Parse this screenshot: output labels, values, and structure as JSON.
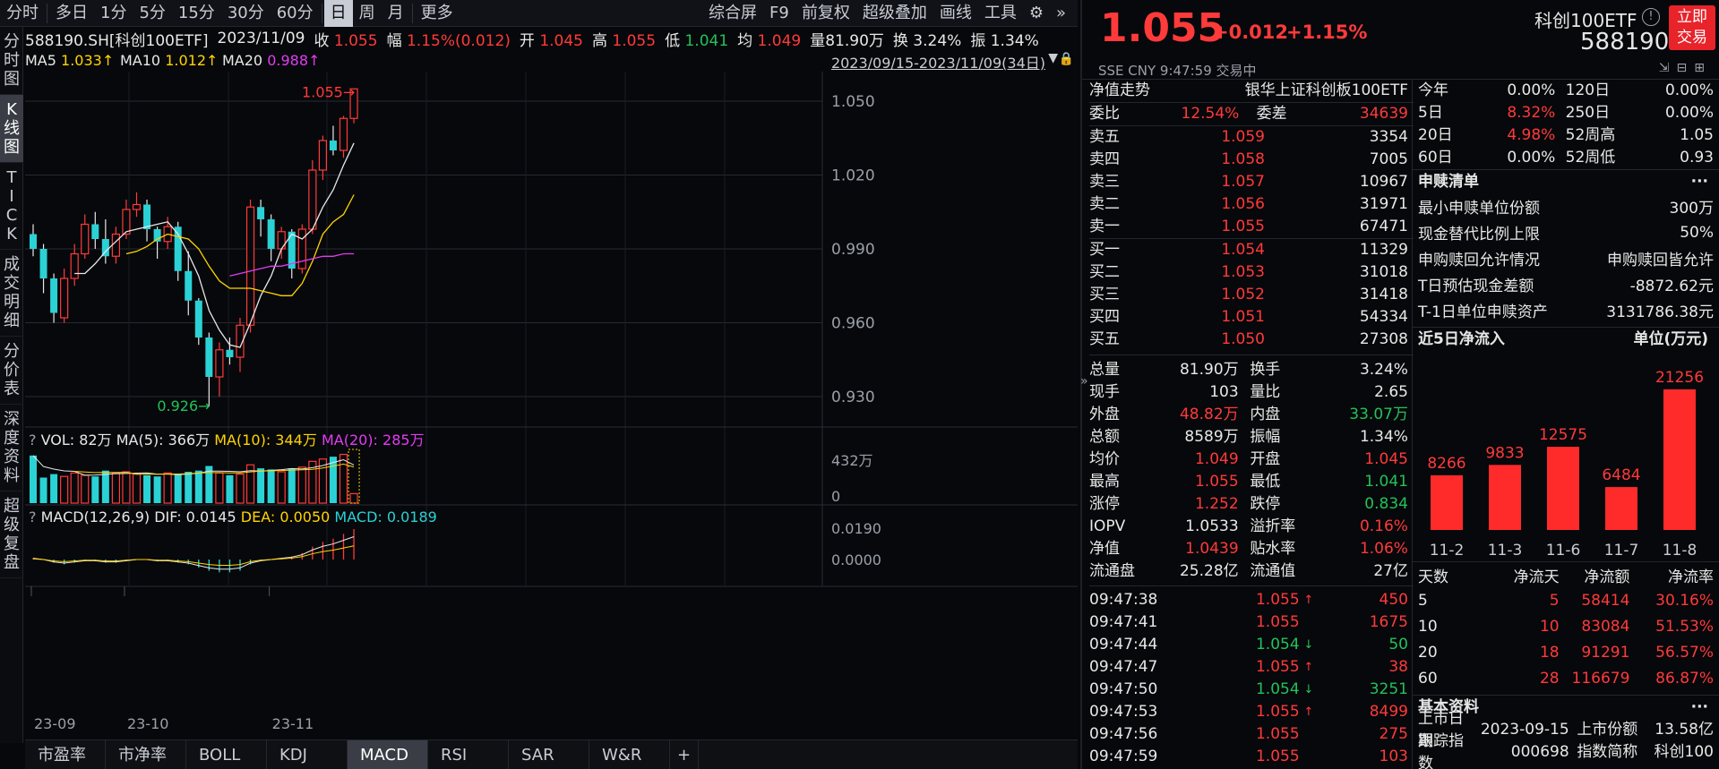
{
  "toolbar": {
    "periods": [
      "分时",
      "多日",
      "1分",
      "5分",
      "15分",
      "30分",
      "60分",
      "日",
      "周",
      "月",
      "更多"
    ],
    "active_period": "日",
    "right_items": [
      "综合屏",
      "F9",
      "前复权",
      "超级叠加",
      "画线",
      "工具"
    ],
    "gear_label": "⚙",
    "expand_label": "»"
  },
  "side_tabs": [
    "分时图",
    "K线图",
    "TICK",
    "成交明细",
    "分价表",
    "深度资料",
    "超级复盘"
  ],
  "active_side_tab": "K线图",
  "info": {
    "code": "588190.SH[科创100ETF]",
    "date": "2023/11/09",
    "close_label": "收",
    "close": "1.055",
    "amp_label": "幅",
    "amp": "1.15%(0.012)",
    "open_label": "开",
    "open": "1.045",
    "high_label": "高",
    "high": "1.055",
    "low_label": "低",
    "low": "1.041",
    "avg_label": "均",
    "avg": "1.049",
    "vol_label": "量",
    "vol": "81.90万",
    "turn_label": "换",
    "turn": "3.24%",
    "zhen_label": "振",
    "zhen": "1.34%"
  },
  "ma_row": {
    "ma5_label": "MA5",
    "ma5": "1.033↑",
    "ma10_label": "MA10",
    "ma10": "1.012↑",
    "ma20_label": "MA20",
    "ma20": "0.988↑",
    "range": "2023/09/15-2023/11/09(34日)"
  },
  "kline": {
    "price_ticks": [
      "1.050",
      "1.020",
      "0.990",
      "0.960",
      "0.930"
    ],
    "ymin": 0.918,
    "ymax": 1.062,
    "max_label": "1.055",
    "min_label": "0.926",
    "colors": {
      "up": "#ff3a3a",
      "down": "#2ad2d6",
      "ma5": "#e8e8e8",
      "ma10": "#ffd400",
      "ma20": "#e23cf3",
      "grid": "#262a31"
    },
    "candles": [
      [
        0.996,
        1.0,
        0.987,
        0.99
      ],
      [
        0.99,
        0.992,
        0.972,
        0.978
      ],
      [
        0.978,
        0.98,
        0.96,
        0.964
      ],
      [
        0.962,
        0.982,
        0.96,
        0.978
      ],
      [
        0.978,
        0.992,
        0.975,
        0.988
      ],
      [
        0.988,
        1.004,
        0.986,
        1.0
      ],
      [
        1.0,
        1.005,
        0.99,
        0.994
      ],
      [
        0.994,
        1.002,
        0.984,
        0.987
      ],
      [
        0.987,
        0.999,
        0.984,
        0.996
      ],
      [
        0.996,
        1.01,
        0.994,
        1.006
      ],
      [
        1.006,
        1.013,
        1.003,
        1.008
      ],
      [
        1.008,
        1.01,
        0.993,
        0.998
      ],
      [
        0.998,
        0.999,
        0.986,
        0.993
      ],
      [
        0.993,
        1.003,
        0.99,
        0.999
      ],
      [
        0.999,
        1.001,
        0.977,
        0.981
      ],
      [
        0.981,
        0.989,
        0.963,
        0.969
      ],
      [
        0.969,
        0.97,
        0.951,
        0.954
      ],
      [
        0.954,
        0.956,
        0.926,
        0.938
      ],
      [
        0.938,
        0.952,
        0.93,
        0.949
      ],
      [
        0.949,
        0.954,
        0.943,
        0.946
      ],
      [
        0.946,
        0.962,
        0.94,
        0.959
      ],
      [
        0.959,
        1.01,
        0.956,
        1.007
      ],
      [
        1.007,
        1.01,
        0.995,
        1.002
      ],
      [
        1.002,
        1.004,
        0.985,
        0.99
      ],
      [
        0.99,
        0.999,
        0.986,
        0.997
      ],
      [
        0.997,
        0.998,
        0.978,
        0.982
      ],
      [
        0.982,
        1.0,
        0.98,
        0.998
      ],
      [
        0.998,
        1.026,
        0.996,
        1.022
      ],
      [
        1.022,
        1.036,
        1.018,
        1.034
      ],
      [
        1.034,
        1.04,
        1.028,
        1.03
      ],
      [
        1.03,
        1.044,
        1.027,
        1.043
      ],
      [
        1.043,
        1.055,
        1.041,
        1.055
      ]
    ],
    "ma5": [
      null,
      null,
      null,
      null,
      0.98,
      0.98,
      0.984,
      0.989,
      0.993,
      0.997,
      0.998,
      0.999,
      1.0,
      1.001,
      0.996,
      0.988,
      0.979,
      0.965,
      0.957,
      0.951,
      0.95,
      0.96,
      0.971,
      0.979,
      0.99,
      0.996,
      0.994,
      0.998,
      1.007,
      1.014,
      1.024,
      1.033
    ],
    "ma10": [
      null,
      null,
      null,
      null,
      null,
      null,
      null,
      null,
      null,
      0.988,
      0.989,
      0.991,
      0.994,
      0.996,
      0.995,
      0.994,
      0.99,
      0.983,
      0.977,
      0.974,
      0.974,
      0.974,
      0.973,
      0.972,
      0.971,
      0.971,
      0.976,
      0.985,
      0.996,
      1.001,
      1.004,
      1.012
    ],
    "ma20": [
      null,
      null,
      null,
      null,
      null,
      null,
      null,
      null,
      null,
      null,
      null,
      null,
      null,
      null,
      null,
      null,
      null,
      null,
      null,
      0.979,
      0.98,
      0.981,
      0.982,
      0.983,
      0.983,
      0.984,
      0.985,
      0.986,
      0.987,
      0.987,
      0.988,
      0.988
    ],
    "date_labels": [
      "23-09",
      "23-10",
      "23-11"
    ]
  },
  "volume": {
    "title": "VOL: 82万",
    "ma5_label": "MA(5): 366万",
    "ma10_label": "MA(10): 344万",
    "ma20_label": "MA(20): 285万",
    "ticks": [
      "432万",
      "0"
    ],
    "max": 432,
    "values": [
      410,
      220,
      250,
      230,
      260,
      240,
      230,
      280,
      260,
      270,
      250,
      240,
      230,
      260,
      250,
      270,
      280,
      320,
      260,
      240,
      250,
      330,
      300,
      290,
      270,
      300,
      310,
      360,
      380,
      400,
      420,
      82
    ]
  },
  "macd": {
    "title": "MACD(12,26,9)",
    "dif_label": "DIF: 0.0145",
    "dea_label": "DEA: 0.0050",
    "macd_label": "MACD: 0.0189",
    "ticks": [
      "0.0190",
      "0.0000"
    ],
    "values": [
      0.001,
      0.0,
      -0.002,
      -0.003,
      -0.002,
      -0.001,
      -0.001,
      -0.002,
      -0.002,
      -0.001,
      0.0,
      0.0,
      -0.001,
      -0.001,
      -0.002,
      -0.003,
      -0.005,
      -0.007,
      -0.008,
      -0.008,
      -0.007,
      -0.003,
      -0.001,
      0.0,
      0.001,
      0.002,
      0.004,
      0.008,
      0.011,
      0.013,
      0.016,
      0.019
    ]
  },
  "bottom_tabs": [
    "市盈率",
    "市净率",
    "BOLL",
    "KDJ",
    "MACD",
    "RSI",
    "SAR",
    "W&R"
  ],
  "active_bottom_tab": "MACD",
  "plus_label": "+",
  "quote": {
    "price": "1.055",
    "change": "+0.012",
    "pct": "+1.15%",
    "name": "科创100ETF",
    "code": "588190",
    "trade_btn_line1": "立即",
    "trade_btn_line2": "交易",
    "market": "SSE  CNY  9:47:59  交易中"
  },
  "book": {
    "nav_title": "净值走势",
    "index_name": "银华上证科创板100ETF",
    "weibi_label": "委比",
    "weibi": "12.54%",
    "weicha_label": "委差",
    "weicha": "34639",
    "asks": [
      [
        "卖五",
        "1.059",
        "3354"
      ],
      [
        "卖四",
        "1.058",
        "7005"
      ],
      [
        "卖三",
        "1.057",
        "10967"
      ],
      [
        "卖二",
        "1.056",
        "31971"
      ],
      [
        "卖一",
        "1.055",
        "67471"
      ]
    ],
    "bids": [
      [
        "买一",
        "1.054",
        "11329"
      ],
      [
        "买二",
        "1.053",
        "31018"
      ],
      [
        "买三",
        "1.052",
        "31418"
      ],
      [
        "买四",
        "1.051",
        "54334"
      ],
      [
        "买五",
        "1.050",
        "27308"
      ]
    ]
  },
  "stats": [
    [
      [
        "总量",
        "81.90万",
        "white"
      ],
      [
        "换手",
        "3.24%",
        "white"
      ]
    ],
    [
      [
        "现手",
        "103",
        "white"
      ],
      [
        "量比",
        "2.65",
        "white"
      ]
    ],
    [
      [
        "外盘",
        "48.82万",
        "red"
      ],
      [
        "内盘",
        "33.07万",
        "green"
      ]
    ],
    [
      [
        "总额",
        "8589万",
        "white"
      ],
      [
        "振幅",
        "1.34%",
        "white"
      ]
    ],
    [
      [
        "均价",
        "1.049",
        "red"
      ],
      [
        "开盘",
        "1.045",
        "red"
      ]
    ],
    [
      [
        "最高",
        "1.055",
        "red"
      ],
      [
        "最低",
        "1.041",
        "green"
      ]
    ],
    [
      [
        "涨停",
        "1.252",
        "red"
      ],
      [
        "跌停",
        "0.834",
        "green"
      ]
    ],
    [
      [
        "IOPV",
        "1.0533",
        "white"
      ],
      [
        "溢折率",
        "0.16%",
        "red"
      ]
    ],
    [
      [
        "净值",
        "1.0439",
        "red"
      ],
      [
        "贴水率",
        "1.06%",
        "red"
      ]
    ],
    [
      [
        "流通盘",
        "25.28亿",
        "white"
      ],
      [
        "流通值",
        "27亿",
        "white"
      ]
    ]
  ],
  "ticks_list": [
    [
      "09:47:38",
      "1.055",
      "↑",
      "450",
      "red"
    ],
    [
      "09:47:41",
      "1.055",
      "",
      "1675",
      "red"
    ],
    [
      "09:47:44",
      "1.054",
      "↓",
      "50",
      "green"
    ],
    [
      "09:47:47",
      "1.055",
      "↑",
      "38",
      "red"
    ],
    [
      "09:47:50",
      "1.054",
      "↓",
      "3251",
      "green"
    ],
    [
      "09:47:53",
      "1.055",
      "↑",
      "8499",
      "red"
    ],
    [
      "09:47:56",
      "1.055",
      "",
      "275",
      "red"
    ],
    [
      "09:47:59",
      "1.055",
      "",
      "103",
      "red"
    ]
  ],
  "perf": [
    [
      [
        "今年",
        "0.00%",
        "white"
      ],
      [
        "120日",
        "0.00%",
        "white"
      ]
    ],
    [
      [
        "5日",
        "8.32%",
        "red"
      ],
      [
        "250日",
        "0.00%",
        "white"
      ]
    ],
    [
      [
        "20日",
        "4.98%",
        "red"
      ],
      [
        "52周高",
        "1.05",
        "white"
      ]
    ],
    [
      [
        "60日",
        "0.00%",
        "white"
      ],
      [
        "52周低",
        "0.93",
        "white"
      ]
    ]
  ],
  "redeem": {
    "title": "申赎清单",
    "more": "···",
    "rows": [
      [
        "最小申赎单位份额",
        "300万"
      ],
      [
        "现金替代比例上限",
        "50%"
      ],
      [
        "申购赎回允许情况",
        "申购赎回皆允许"
      ],
      [
        "T日预估现金差额",
        "-8872.62元"
      ],
      [
        "T-1日单位申赎资产",
        "3131786.38元"
      ]
    ]
  },
  "inflow": {
    "title": "近5日净流入",
    "unit": "单位(万元)",
    "bars": [
      [
        "11-2",
        8266
      ],
      [
        "11-3",
        9833
      ],
      [
        "11-6",
        12575
      ],
      [
        "11-7",
        6484
      ],
      [
        "11-8",
        21256
      ]
    ],
    "max": 23000,
    "bar_color": "#ff2a2a"
  },
  "flowtable": {
    "headers": [
      "天数",
      "净流天",
      "净流额",
      "净流率"
    ],
    "rows": [
      [
        "5",
        "5",
        "58414",
        "30.16%"
      ],
      [
        "10",
        "10",
        "83084",
        "51.53%"
      ],
      [
        "20",
        "18",
        "91291",
        "56.57%"
      ],
      [
        "60",
        "28",
        "116679",
        "86.87%"
      ]
    ]
  },
  "basic": {
    "title": "基本资料",
    "more": "···",
    "row1": [
      "上市日期",
      "2023-09-15",
      "上市份额",
      "13.58亿"
    ],
    "row2": [
      "跟踪指数",
      "000698",
      "指数简称",
      "科创100"
    ]
  }
}
